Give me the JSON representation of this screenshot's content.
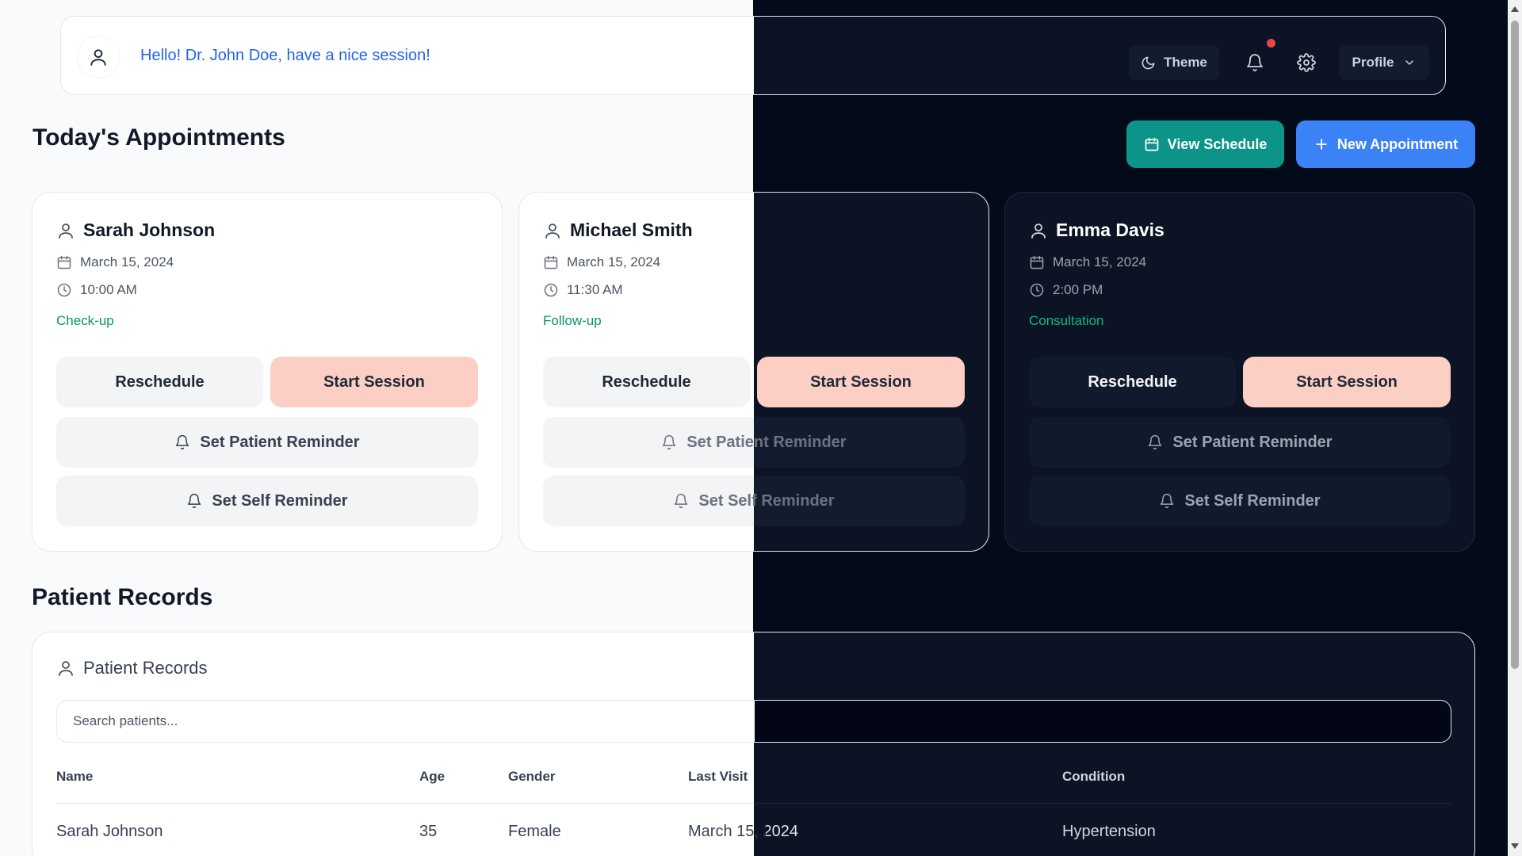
{
  "header": {
    "greeting": "Hello! Dr. John Doe, have a nice session!",
    "theme_label": "Theme",
    "profile_label": "Profile"
  },
  "appointments": {
    "title": "Today's Appointments",
    "view_schedule_label": "View Schedule",
    "new_appointment_label": "New Appointment",
    "cards": [
      {
        "name": "Sarah Johnson",
        "date": "March 15, 2024",
        "time": "10:00 AM",
        "type": "Check-up",
        "reschedule_label": "Reschedule",
        "start_label": "Start Session",
        "patient_reminder_label": "Set Patient Reminder",
        "self_reminder_label": "Set Self Reminder"
      },
      {
        "name": "Michael Smith",
        "date": "March 15, 2024",
        "time": "11:30 AM",
        "type": "Follow-up",
        "reschedule_label": "Reschedule",
        "start_label": "Start Session",
        "patient_reminder_label": "Set Patient Reminder",
        "self_reminder_label": "Set Self Reminder"
      },
      {
        "name": "Emma Davis",
        "date": "March 15, 2024",
        "time": "2:00 PM",
        "type": "Consultation",
        "reschedule_label": "Reschedule",
        "start_label": "Start Session",
        "patient_reminder_label": "Set Patient Reminder",
        "self_reminder_label": "Set Self Reminder"
      }
    ]
  },
  "records": {
    "section_title": "Patient Records",
    "panel_title": "Patient Records",
    "search_placeholder": "Search patients...",
    "columns": [
      "Name",
      "Age",
      "Gender",
      "Last Visit",
      "Condition"
    ],
    "rows": [
      [
        "Sarah Johnson",
        "35",
        "Female",
        "March 15, 2024",
        "Hypertension"
      ]
    ]
  },
  "colors": {
    "accent_blue": "#3b82f6",
    "accent_teal": "#0d9488",
    "start_session": "#fbcfc3",
    "appointment_type": "#059669",
    "notification_dot": "#ef4444"
  },
  "icons": [
    "user-icon",
    "moon-icon",
    "bell-icon",
    "gear-icon",
    "chevron-down-icon",
    "calendar-icon",
    "plus-icon",
    "clock-icon"
  ]
}
